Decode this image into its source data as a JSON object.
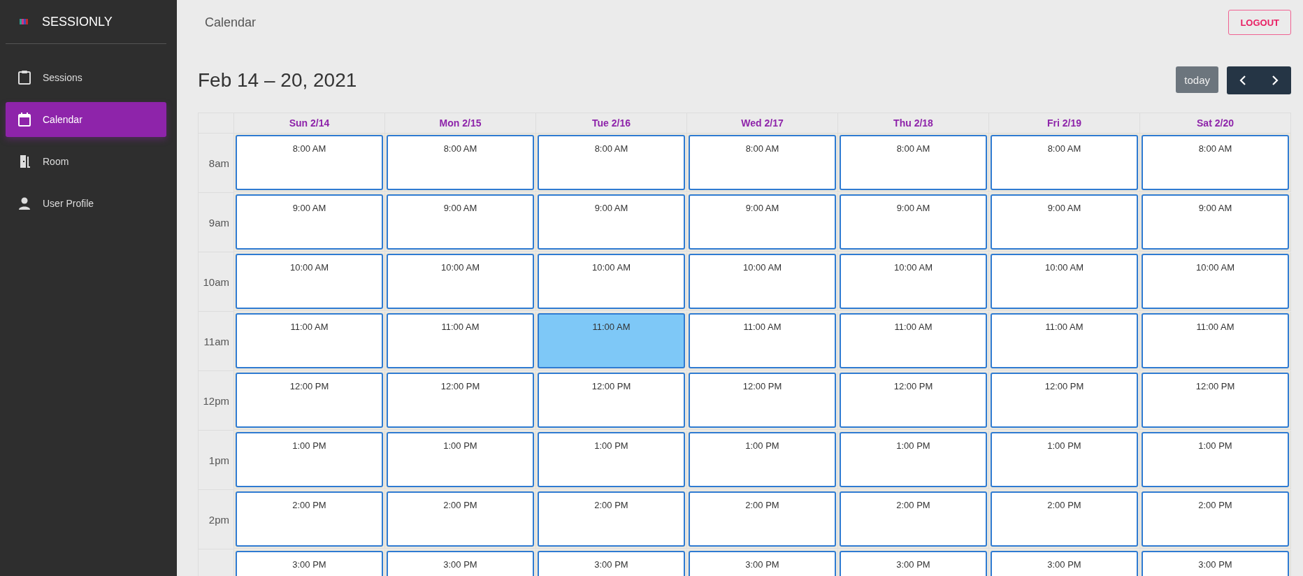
{
  "sidebar": {
    "brand": "SESSIONLY",
    "items": [
      {
        "kind": "clipboard",
        "label": "Sessions",
        "selected": false
      },
      {
        "kind": "calendar",
        "label": "Calendar",
        "selected": true
      },
      {
        "kind": "door",
        "label": "Room",
        "selected": false
      },
      {
        "kind": "person",
        "label": "User Profile",
        "selected": false
      }
    ]
  },
  "header": {
    "title": "Calendar",
    "logout": "LOGOUT"
  },
  "toolbar": {
    "title": "Feb 14 – 20, 2021",
    "today": "today"
  },
  "calendar": {
    "days": [
      "Sun 2/14",
      "Mon 2/15",
      "Tue 2/16",
      "Wed 2/17",
      "Thu 2/18",
      "Fri 2/19",
      "Sat 2/20"
    ],
    "rows": [
      {
        "label": "8am",
        "slots": [
          {
            "text": "8:00 AM",
            "selected": false
          },
          {
            "text": "8:00 AM",
            "selected": false
          },
          {
            "text": "8:00 AM",
            "selected": false
          },
          {
            "text": "8:00 AM",
            "selected": false
          },
          {
            "text": "8:00 AM",
            "selected": false
          },
          {
            "text": "8:00 AM",
            "selected": false
          },
          {
            "text": "8:00 AM",
            "selected": false
          }
        ]
      },
      {
        "label": "9am",
        "slots": [
          {
            "text": "9:00 AM",
            "selected": false
          },
          {
            "text": "9:00 AM",
            "selected": false
          },
          {
            "text": "9:00 AM",
            "selected": false
          },
          {
            "text": "9:00 AM",
            "selected": false
          },
          {
            "text": "9:00 AM",
            "selected": false
          },
          {
            "text": "9:00 AM",
            "selected": false
          },
          {
            "text": "9:00 AM",
            "selected": false
          }
        ]
      },
      {
        "label": "10am",
        "slots": [
          {
            "text": "10:00 AM",
            "selected": false
          },
          {
            "text": "10:00 AM",
            "selected": false
          },
          {
            "text": "10:00 AM",
            "selected": false
          },
          {
            "text": "10:00 AM",
            "selected": false
          },
          {
            "text": "10:00 AM",
            "selected": false
          },
          {
            "text": "10:00 AM",
            "selected": false
          },
          {
            "text": "10:00 AM",
            "selected": false
          }
        ]
      },
      {
        "label": "11am",
        "slots": [
          {
            "text": "11:00 AM",
            "selected": false
          },
          {
            "text": "11:00 AM",
            "selected": false
          },
          {
            "text": "11:00 AM",
            "selected": true
          },
          {
            "text": "11:00 AM",
            "selected": false
          },
          {
            "text": "11:00 AM",
            "selected": false
          },
          {
            "text": "11:00 AM",
            "selected": false
          },
          {
            "text": "11:00 AM",
            "selected": false
          }
        ]
      },
      {
        "label": "12pm",
        "slots": [
          {
            "text": "12:00 PM",
            "selected": false
          },
          {
            "text": "12:00 PM",
            "selected": false
          },
          {
            "text": "12:00 PM",
            "selected": false
          },
          {
            "text": "12:00 PM",
            "selected": false
          },
          {
            "text": "12:00 PM",
            "selected": false
          },
          {
            "text": "12:00 PM",
            "selected": false
          },
          {
            "text": "12:00 PM",
            "selected": false
          }
        ]
      },
      {
        "label": "1pm",
        "slots": [
          {
            "text": "1:00 PM",
            "selected": false
          },
          {
            "text": "1:00 PM",
            "selected": false
          },
          {
            "text": "1:00 PM",
            "selected": false
          },
          {
            "text": "1:00 PM",
            "selected": false
          },
          {
            "text": "1:00 PM",
            "selected": false
          },
          {
            "text": "1:00 PM",
            "selected": false
          },
          {
            "text": "1:00 PM",
            "selected": false
          }
        ]
      },
      {
        "label": "2pm",
        "slots": [
          {
            "text": "2:00 PM",
            "selected": false
          },
          {
            "text": "2:00 PM",
            "selected": false
          },
          {
            "text": "2:00 PM",
            "selected": false
          },
          {
            "text": "2:00 PM",
            "selected": false
          },
          {
            "text": "2:00 PM",
            "selected": false
          },
          {
            "text": "2:00 PM",
            "selected": false
          },
          {
            "text": "2:00 PM",
            "selected": false
          }
        ]
      },
      {
        "slots": [
          {
            "text": "3:00 PM",
            "selected": false
          },
          {
            "text": "3:00 PM",
            "selected": false
          },
          {
            "text": "3:00 PM",
            "selected": false
          },
          {
            "text": "3:00 PM",
            "selected": false
          },
          {
            "text": "3:00 PM",
            "selected": false
          },
          {
            "text": "3:00 PM",
            "selected": false
          },
          {
            "text": "3:00 PM",
            "selected": false
          }
        ]
      }
    ]
  }
}
